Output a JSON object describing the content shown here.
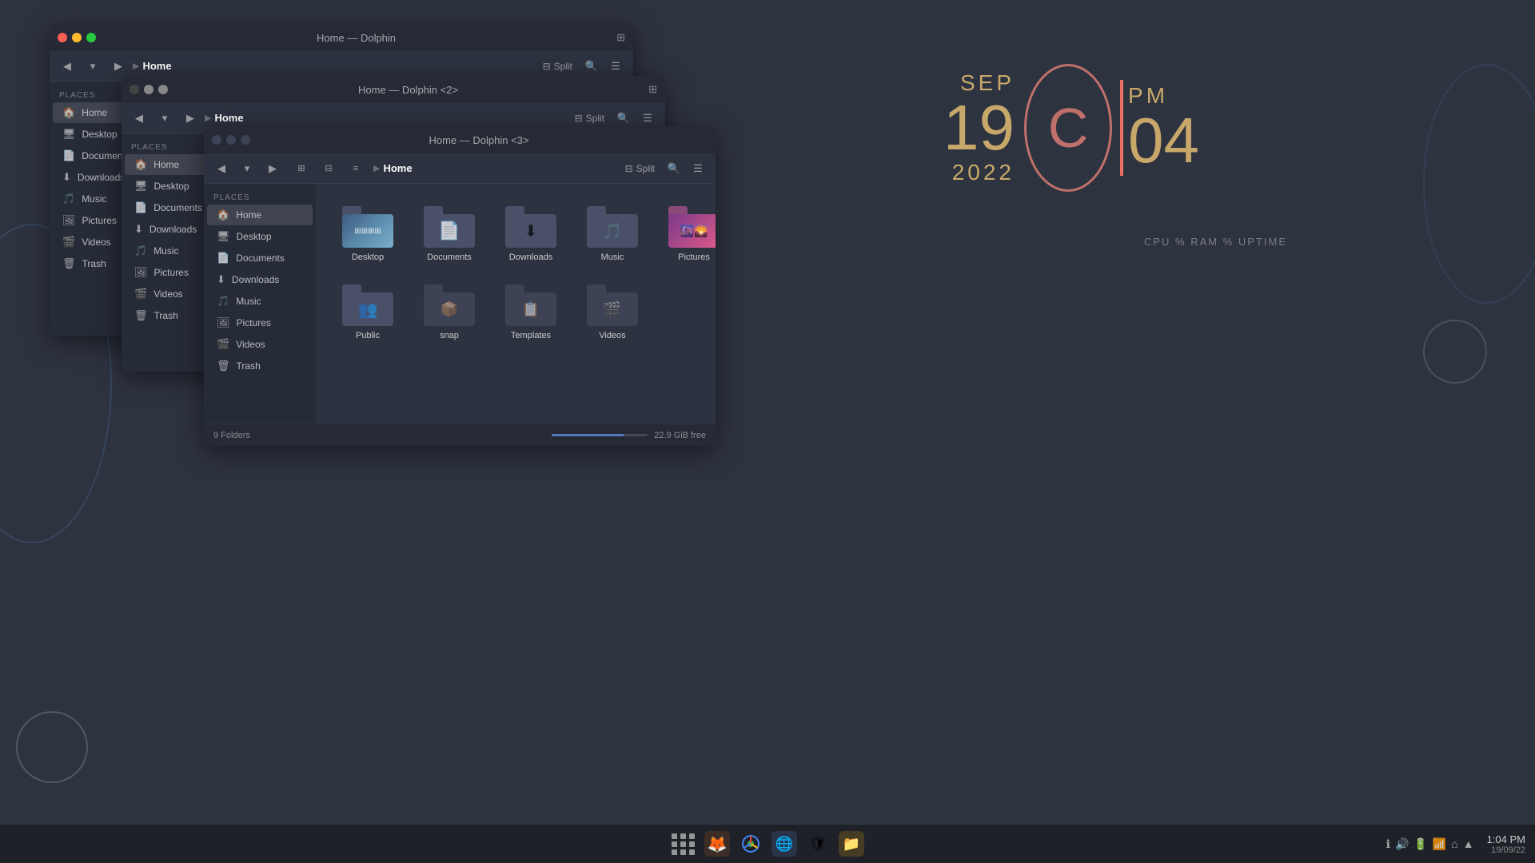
{
  "desktop": {
    "background_color": "#2e3340"
  },
  "clock": {
    "month": "SEP",
    "day": "19",
    "year": "2022",
    "period": "PM",
    "hour": "04",
    "letter": "C"
  },
  "sys_stats": {
    "label": "CPU %  RAM %  UPTIME"
  },
  "window1": {
    "title": "Home — Dolphin",
    "toolbar": {
      "breadcrumb": "Home",
      "split_label": "Split"
    },
    "sidebar": {
      "section": "Places",
      "items": [
        {
          "label": "Home",
          "icon": "🏠"
        },
        {
          "label": "Desktop",
          "icon": "🖥"
        },
        {
          "label": "Documents",
          "icon": "📄"
        },
        {
          "label": "Downloads",
          "icon": "⬇"
        },
        {
          "label": "Music",
          "icon": "🎵"
        },
        {
          "label": "Pictures",
          "icon": "🖼"
        },
        {
          "label": "Videos",
          "icon": "🎬"
        },
        {
          "label": "Trash",
          "icon": "🗑"
        }
      ]
    }
  },
  "window2": {
    "title": "Home — Dolphin <2>",
    "toolbar": {
      "breadcrumb": "Home",
      "split_label": "Split"
    },
    "sidebar": {
      "section": "Places",
      "items": [
        {
          "label": "Home",
          "icon": "🏠"
        },
        {
          "label": "Desktop",
          "icon": "🖥"
        },
        {
          "label": "Documents",
          "icon": "📄"
        },
        {
          "label": "Downloads",
          "icon": "⬇"
        },
        {
          "label": "Music",
          "icon": "🎵"
        },
        {
          "label": "Pictures",
          "icon": "🖼"
        },
        {
          "label": "Videos",
          "icon": "🎬"
        },
        {
          "label": "Trash",
          "icon": "🗑"
        }
      ]
    }
  },
  "window3": {
    "title": "Home — Dolphin <3>",
    "toolbar": {
      "breadcrumb": "Home",
      "split_label": "Split"
    },
    "sidebar": {
      "section": "Places",
      "items": [
        {
          "label": "Home",
          "icon": "🏠"
        },
        {
          "label": "Desktop",
          "icon": "🖥"
        },
        {
          "label": "Documents",
          "icon": "📄"
        },
        {
          "label": "Downloads",
          "icon": "⬇"
        },
        {
          "label": "Music",
          "icon": "🎵"
        },
        {
          "label": "Pictures",
          "icon": "🖼"
        },
        {
          "label": "Videos",
          "icon": "🎬"
        },
        {
          "label": "Trash",
          "icon": "🗑"
        }
      ]
    },
    "folders": [
      {
        "name": "Desktop",
        "type": "desktop"
      },
      {
        "name": "Documents",
        "type": "documents"
      },
      {
        "name": "Downloads",
        "type": "downloads"
      },
      {
        "name": "Music",
        "type": "music"
      },
      {
        "name": "Pictures",
        "type": "pictures"
      },
      {
        "name": "Public",
        "type": "public"
      },
      {
        "name": "snap",
        "type": "snap"
      },
      {
        "name": "Templates",
        "type": "templates"
      },
      {
        "name": "Videos",
        "type": "videos"
      }
    ],
    "status": {
      "folders_count": "9 Folders",
      "free_space": "22.9 GiB free"
    }
  },
  "taskbar": {
    "apps": [
      {
        "name": "Firefox",
        "color": "#e87722"
      },
      {
        "name": "Chrome",
        "color": "#4285f4"
      },
      {
        "name": "App3",
        "color": "#5a7fc7"
      },
      {
        "name": "App4",
        "color": "#555"
      },
      {
        "name": "App5",
        "color": "#e8a010"
      }
    ],
    "time": "1:04 PM",
    "date": "19/09/22",
    "sys_icons": [
      "ℹ",
      "🔊",
      "🔋",
      "📶",
      "⌂"
    ]
  }
}
